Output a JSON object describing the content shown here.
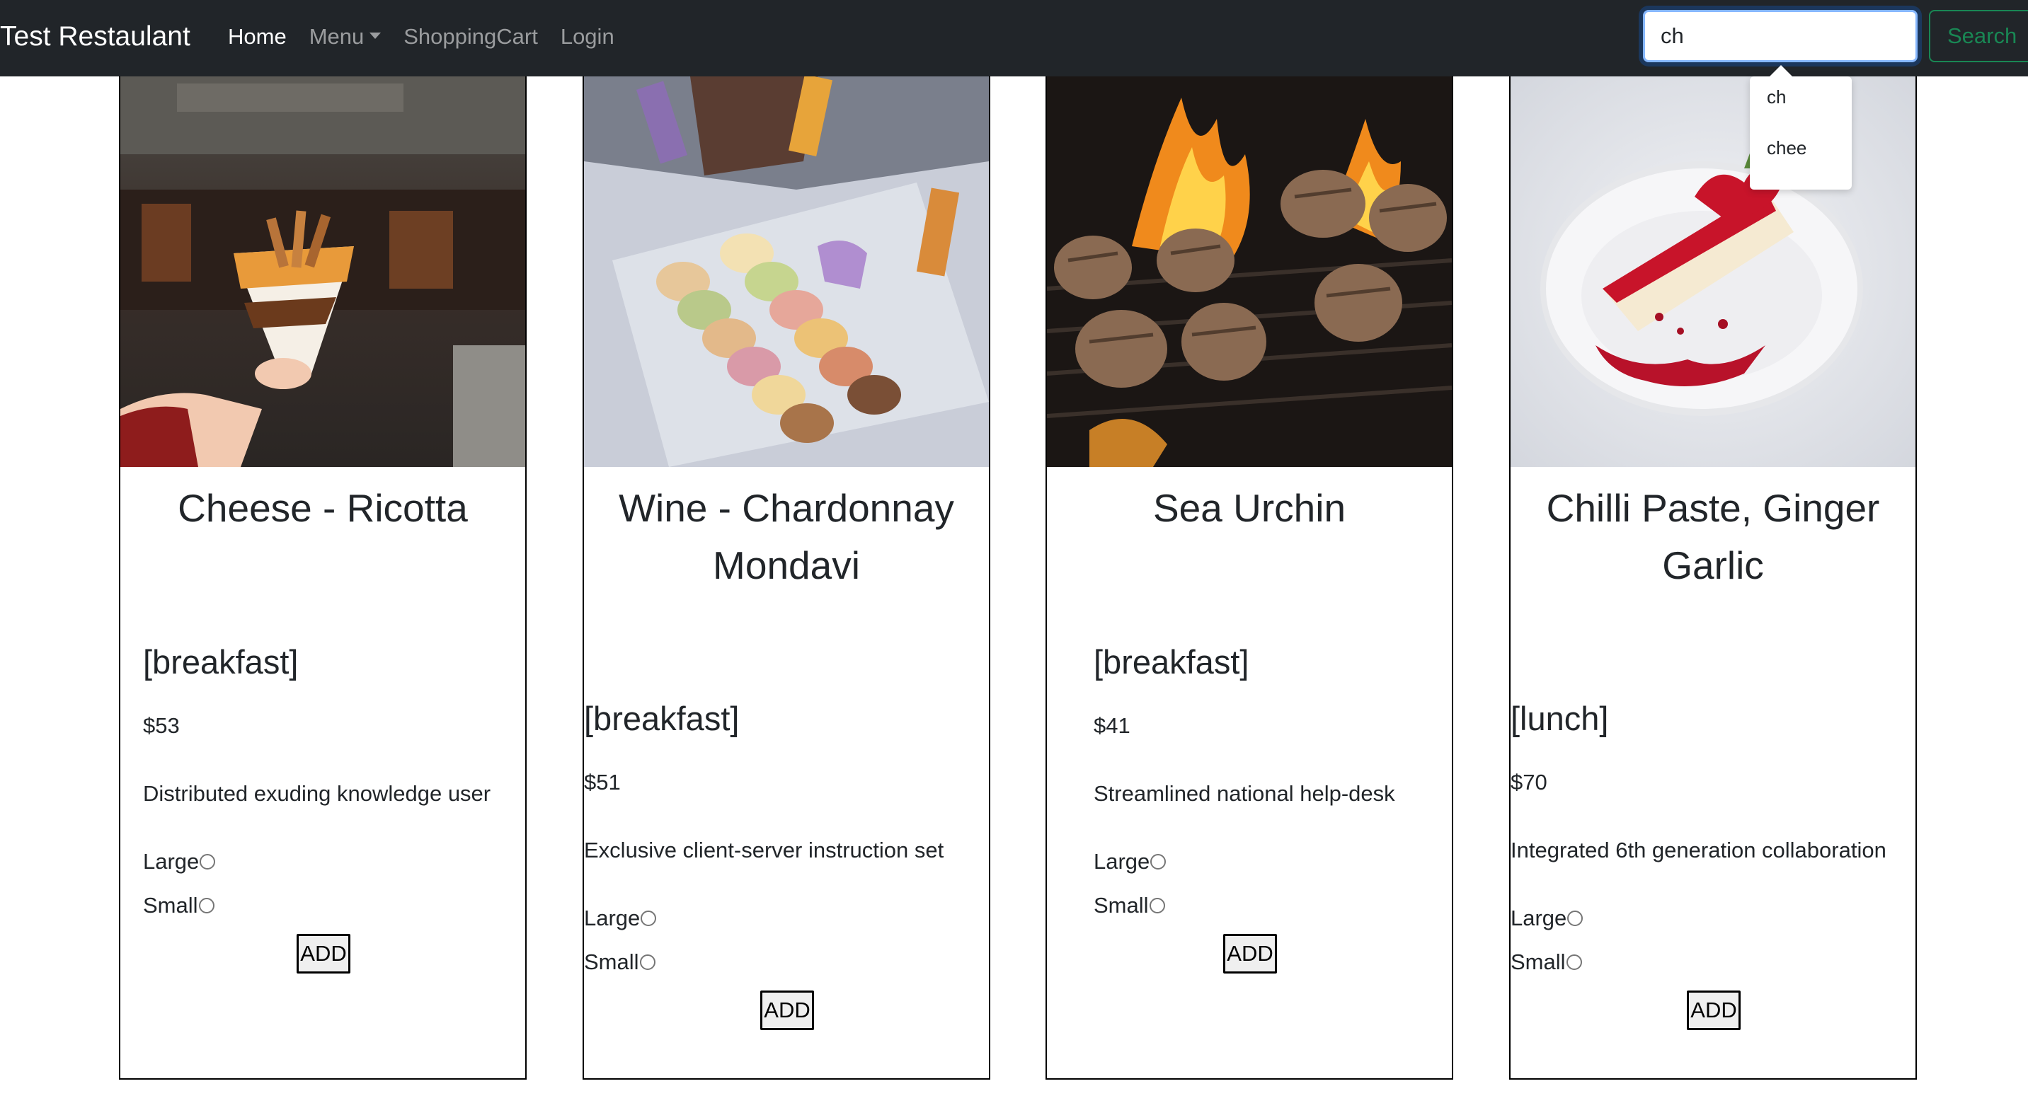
{
  "navbar": {
    "brand": "Test Restaulant",
    "links": {
      "home": "Home",
      "menu": "Menu",
      "cart": "ShoppingCart",
      "login": "Login"
    },
    "search": {
      "value": "ch",
      "button": "Search"
    }
  },
  "autocomplete": [
    "ch",
    "chee"
  ],
  "cards": [
    {
      "name": "Cheese - Ricotta",
      "meal": "[breakfast]",
      "price": "$53",
      "description": "Distributed exuding knowledge user",
      "options": [
        "Large",
        "Small"
      ],
      "add": "ADD"
    },
    {
      "name": "Wine - Chardonnay Mondavi",
      "meal": "[breakfast]",
      "price": "$51",
      "description": "Exclusive client-server instruction set",
      "options": [
        "Large",
        "Small"
      ],
      "add": "ADD"
    },
    {
      "name": "Sea Urchin",
      "meal": "[breakfast]",
      "price": "$41",
      "description": "Streamlined national help-desk",
      "options": [
        "Large",
        "Small"
      ],
      "add": "ADD"
    },
    {
      "name": "Chilli Paste, Ginger Garlic",
      "meal": "[lunch]",
      "price": "$70",
      "description": "Integrated 6th generation collaboration",
      "options": [
        "Large",
        "Small"
      ],
      "add": "ADD"
    }
  ]
}
